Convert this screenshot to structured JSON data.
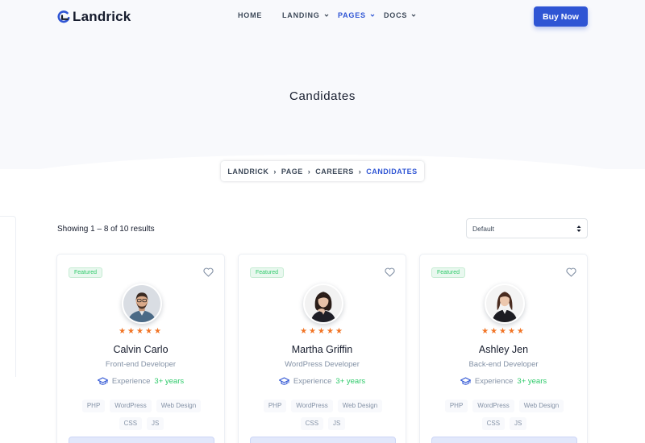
{
  "brand": {
    "name": "Landrick"
  },
  "nav": {
    "items": [
      {
        "label": "HOME",
        "has_dropdown": false,
        "active": false
      },
      {
        "label": "LANDING",
        "has_dropdown": true,
        "active": false
      },
      {
        "label": "PAGES",
        "has_dropdown": true,
        "active": true
      },
      {
        "label": "DOCS",
        "has_dropdown": true,
        "active": false
      }
    ],
    "cta_label": "Buy Now"
  },
  "hero": {
    "title": "Candidates",
    "breadcrumb": [
      "LANDRICK",
      "PAGE",
      "CAREERS",
      "CANDIDATES"
    ]
  },
  "listing": {
    "results_text": "Showing 1 – 8 of 10 results",
    "sort_selected": "Default"
  },
  "candidates": [
    {
      "badge": "Featured",
      "rating": 5,
      "stars": "★★★★★",
      "name": "Calvin Carlo",
      "role": "Front-end Developer",
      "experience_label": "Experience",
      "experience_value": "3+ years",
      "skills": [
        "PHP",
        "WordPress",
        "Web Design",
        "CSS",
        "JS"
      ]
    },
    {
      "badge": "Featured",
      "rating": 5,
      "stars": "★★★★★",
      "name": "Martha Griffin",
      "role": "WordPress Developer",
      "experience_label": "Experience",
      "experience_value": "3+ years",
      "skills": [
        "PHP",
        "WordPress",
        "Web Design",
        "CSS",
        "JS"
      ]
    },
    {
      "badge": "Featured",
      "rating": 5,
      "stars": "★★★★★",
      "name": "Ashley Jen",
      "role": "Back-end Developer",
      "experience_label": "Experience",
      "experience_value": "3+ years",
      "skills": [
        "PHP",
        "WordPress",
        "Web Design",
        "CSS",
        "JS"
      ]
    }
  ],
  "icons": {
    "logo": "landrick-logo-icon",
    "dropdown": "chevron-down-icon",
    "favorite": "heart-icon",
    "experience": "graduation-cap-icon",
    "sort": "sort-arrows-icon"
  },
  "colors": {
    "primary": "#2f55d4",
    "success": "#2eca6a",
    "star": "#f17425",
    "hero_bg": "#f8f9fc",
    "heading": "#161c2d",
    "muted": "#8492a6"
  }
}
